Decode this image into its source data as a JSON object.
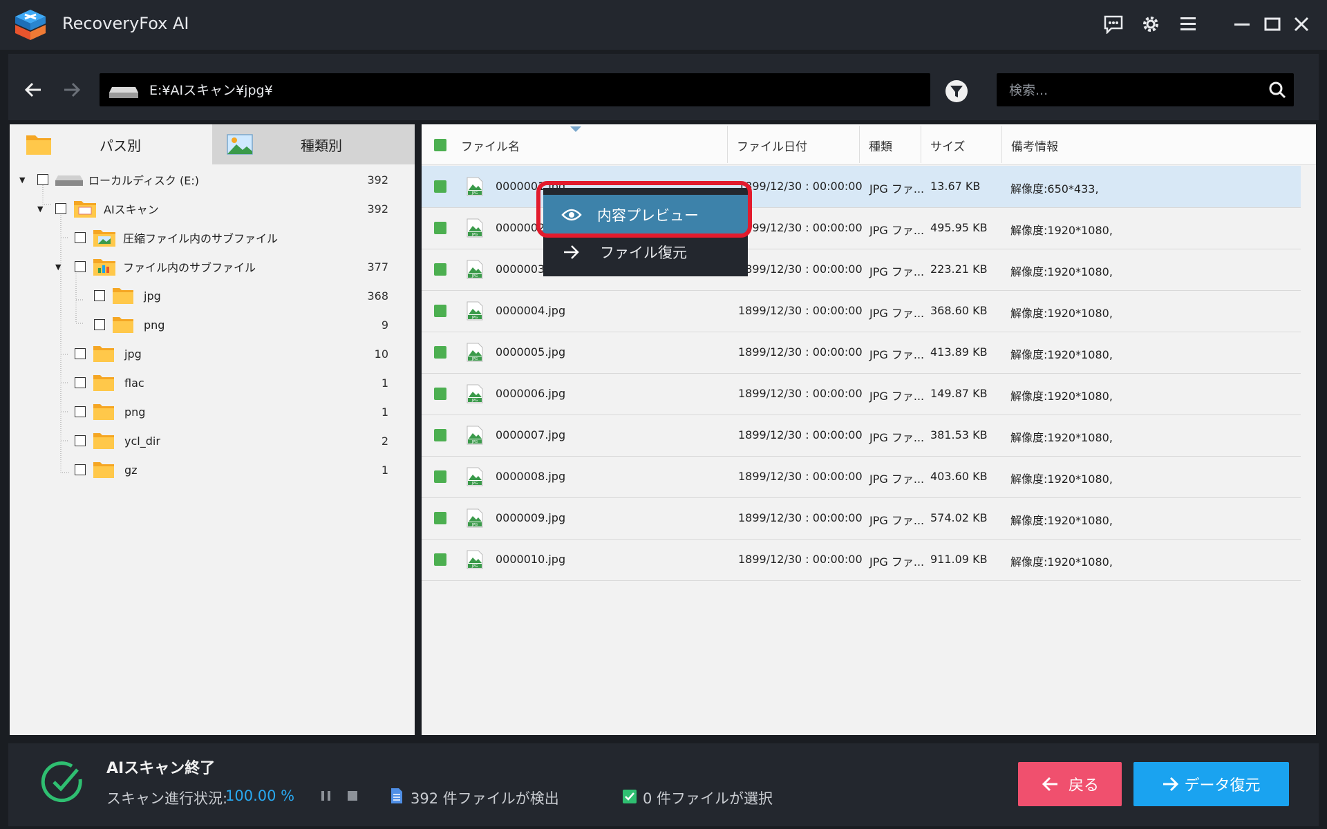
{
  "app": {
    "title": "RecoveryFox AI"
  },
  "nav": {
    "path": "E:¥AIスキャン¥jpg¥",
    "search_placeholder": "検索..."
  },
  "tabs": [
    {
      "label": "パス別"
    },
    {
      "label": "種類別"
    }
  ],
  "tree": [
    {
      "label": "ローカルディスク (E:)",
      "count": "392"
    },
    {
      "label": "AIスキャン",
      "count": "392"
    },
    {
      "label": "圧縮ファイル内のサブファイル",
      "count": ""
    },
    {
      "label": "ファイル内のサブファイル",
      "count": "377"
    },
    {
      "label": "jpg",
      "count": "368"
    },
    {
      "label": "png",
      "count": "9"
    },
    {
      "label": "jpg",
      "count": "10"
    },
    {
      "label": "flac",
      "count": "1"
    },
    {
      "label": "png",
      "count": "1"
    },
    {
      "label": "ycl_dir",
      "count": "2"
    },
    {
      "label": "gz",
      "count": "1"
    }
  ],
  "columns": {
    "name": "ファイル名",
    "date": "ファイル日付",
    "type": "種類",
    "size": "サイズ",
    "note": "備考情報"
  },
  "files": [
    {
      "name": "0000001.jpg",
      "date": "1899/12/30 : 00:00:00",
      "type": "JPG ファ...",
      "size": "13.67 KB",
      "note": "解像度:650*433,"
    },
    {
      "name": "0000002.jpg",
      "date": "1899/12/30 : 00:00:00",
      "type": "JPG ファ...",
      "size": "495.95 KB",
      "note": "解像度:1920*1080,"
    },
    {
      "name": "0000003.jpg",
      "date": "1899/12/30 : 00:00:00",
      "type": "JPG ファ...",
      "size": "223.21 KB",
      "note": "解像度:1920*1080,"
    },
    {
      "name": "0000004.jpg",
      "date": "1899/12/30 : 00:00:00",
      "type": "JPG ファ...",
      "size": "368.60 KB",
      "note": "解像度:1920*1080,"
    },
    {
      "name": "0000005.jpg",
      "date": "1899/12/30 : 00:00:00",
      "type": "JPG ファ...",
      "size": "413.89 KB",
      "note": "解像度:1920*1080,"
    },
    {
      "name": "0000006.jpg",
      "date": "1899/12/30 : 00:00:00",
      "type": "JPG ファ...",
      "size": "149.87 KB",
      "note": "解像度:1920*1080,"
    },
    {
      "name": "0000007.jpg",
      "date": "1899/12/30 : 00:00:00",
      "type": "JPG ファ...",
      "size": "381.53 KB",
      "note": "解像度:1920*1080,"
    },
    {
      "name": "0000008.jpg",
      "date": "1899/12/30 : 00:00:00",
      "type": "JPG ファ...",
      "size": "403.60 KB",
      "note": "解像度:1920*1080,"
    },
    {
      "name": "0000009.jpg",
      "date": "1899/12/30 : 00:00:00",
      "type": "JPG ファ...",
      "size": "574.02 KB",
      "note": "解像度:1920*1080,"
    },
    {
      "name": "0000010.jpg",
      "date": "1899/12/30 : 00:00:00",
      "type": "JPG ファ...",
      "size": "911.09 KB",
      "note": "解像度:1920*1080,"
    }
  ],
  "context_menu": {
    "preview": "内容プレビュー",
    "recover": "ファイル復元"
  },
  "status": {
    "title": "AIスキャン終了",
    "progress_label": "スキャン進行状況:",
    "progress_value": "100.00 %",
    "found": "392 件ファイルが検出",
    "selected": "0 件ファイルが選択"
  },
  "buttons": {
    "back": "戻る",
    "recover": "データ復元"
  },
  "colors": {
    "accent": "#1aa3f0",
    "back": "#f0506e",
    "highlight": "#e21b2d",
    "menu_active": "#3d82aa"
  }
}
